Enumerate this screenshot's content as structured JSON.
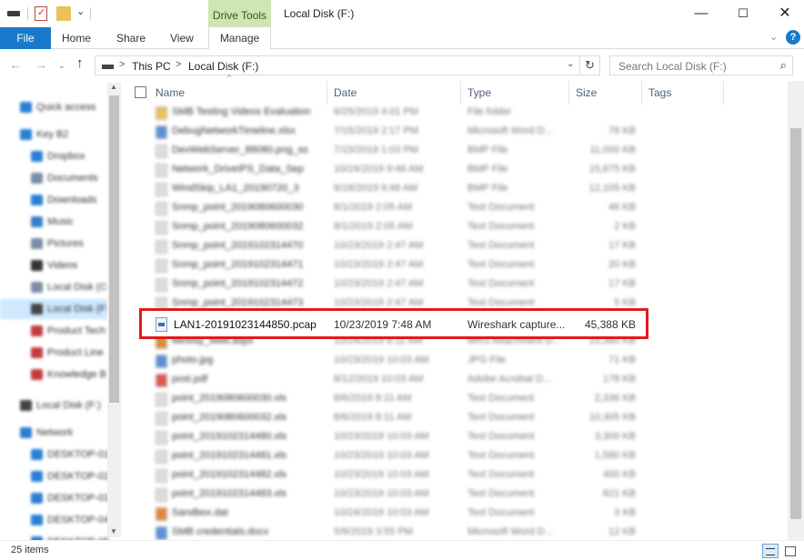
{
  "titlebar": {
    "window_title": "Local Disk (F:)",
    "context_tab": "Drive Tools",
    "minimize": "—",
    "maximize": "☐",
    "close": "✕"
  },
  "ribbon": {
    "file": "File",
    "home": "Home",
    "share": "Share",
    "view": "View",
    "manage": "Manage",
    "help": "?"
  },
  "address": {
    "back": "←",
    "forward": "→",
    "recent": "⌄",
    "up": "↑",
    "crumbs": [
      "This PC",
      "Local Disk (F:)"
    ],
    "separator": ">",
    "dropdown": "⌄",
    "refresh": "↻",
    "search_placeholder": "Search Local Disk (F:)",
    "search_icon": "⌕"
  },
  "nav_pane": {
    "items": [
      {
        "label": "Quick access",
        "color": "#2a7fd4"
      },
      {
        "label": "Key B2",
        "color": "#2a7fd4"
      },
      {
        "label": "Dropbox",
        "color": "#2a7fd4"
      },
      {
        "label": "Documents",
        "color": "#7a8ea6"
      },
      {
        "label": "Downloads",
        "color": "#2a7fd4"
      },
      {
        "label": "Music",
        "color": "#3a7ec9"
      },
      {
        "label": "Pictures",
        "color": "#7a8ea6"
      },
      {
        "label": "Videos",
        "color": "#333333"
      },
      {
        "label": "Local Disk (C:)",
        "color": "#7a8ea6"
      },
      {
        "label": "Local Disk (F:)",
        "color": "#444444",
        "selected": true
      },
      {
        "label": "Product Tech",
        "color": "#c23b3b"
      },
      {
        "label": "Product Line",
        "color": "#c23b3b"
      },
      {
        "label": "Knowledge B",
        "color": "#c23b3b"
      },
      {
        "label": "Local Disk (F:)",
        "color": "#444444"
      },
      {
        "label": "Network",
        "color": "#2a7fd4"
      },
      {
        "label": "DESKTOP-01",
        "color": "#2a7fd4"
      },
      {
        "label": "DESKTOP-02",
        "color": "#2a7fd4"
      },
      {
        "label": "DESKTOP-03",
        "color": "#2a7fd4"
      },
      {
        "label": "DESKTOP-04",
        "color": "#2a7fd4"
      },
      {
        "label": "DESKTOP-05",
        "color": "#2a7fd4"
      }
    ]
  },
  "columns": {
    "name": "Name",
    "date": "Date",
    "type": "Type",
    "size": "Size",
    "tags": "Tags",
    "sort_arrow": "^"
  },
  "files_blurred": [
    {
      "name": "SMB Testing Videos Evaluation",
      "date": "6/25/2019 4:01 PM",
      "type": "File folder",
      "size": "",
      "icon_color": "#e8c35a"
    },
    {
      "name": "DebugNetworkTimeline.xlsx",
      "date": "7/15/2019 2:17 PM",
      "type": "Microsoft Word D...",
      "size": "78 KB",
      "icon_color": "#5b8fd6"
    },
    {
      "name": "DevWebServer_88080.png_ss",
      "date": "7/15/2019 1:03 PM",
      "type": "BMP File",
      "size": "11,000 KB",
      "icon_color": "#dddddd"
    },
    {
      "name": "Network_DriveIPS_Data_Sep",
      "date": "10/24/2019 9:46 AM",
      "type": "BMP File",
      "size": "15,675 KB",
      "icon_color": "#dddddd"
    },
    {
      "name": "WindSkip_LA1_20190720_3",
      "date": "6/18/2019 9:46 AM",
      "type": "BMP File",
      "size": "12,105 KB",
      "icon_color": "#dddddd"
    },
    {
      "name": "Snmp_point_2019080600030",
      "date": "8/1/2019 2:05 AM",
      "type": "Text Document",
      "size": "46 KB",
      "icon_color": "#dddddd"
    },
    {
      "name": "Snmp_point_2019080600032",
      "date": "8/1/2019 2:05 AM",
      "type": "Text Document",
      "size": "2 KB",
      "icon_color": "#dddddd"
    },
    {
      "name": "Snmp_point_2019102314470",
      "date": "10/23/2019 2:47 AM",
      "type": "Text Document",
      "size": "17 KB",
      "icon_color": "#dddddd"
    },
    {
      "name": "Snmp_point_2019102314471",
      "date": "10/23/2019 2:47 AM",
      "type": "Text Document",
      "size": "20 KB",
      "icon_color": "#dddddd"
    },
    {
      "name": "Snmp_point_2019102314472",
      "date": "10/23/2019 2:47 AM",
      "type": "Text Document",
      "size": "17 KB",
      "icon_color": "#dddddd"
    },
    {
      "name": "Snmp_point_2019102314473",
      "date": "10/23/2019 2:47 AM",
      "type": "Text Document",
      "size": "5 KB",
      "icon_color": "#dddddd"
    }
  ],
  "selected_file": {
    "name": "LAN1-20191023144850.pcap",
    "date": "10/23/2019 7:48 AM",
    "type": "Wireshark capture...",
    "size": "45,388 KB"
  },
  "files_blurred_after": [
    {
      "name": "Minosy_Web.aspx",
      "date": "10/24/2019 8:11 AM",
      "type": "MRS Attachment D...",
      "size": "15,380 KB",
      "icon_color": "#e08a3a"
    },
    {
      "name": "photo.jpg",
      "date": "10/23/2019 10:03 AM",
      "type": "JPG File",
      "size": "71 KB",
      "icon_color": "#5b8fd6"
    },
    {
      "name": "post.pdf",
      "date": "8/12/2019 10:03 AM",
      "type": "Adobe Acrobat D...",
      "size": "178 KB",
      "icon_color": "#e05555"
    },
    {
      "name": "point_2019080600030.xls",
      "date": "8/6/2019 8:11 AM",
      "type": "Text Document",
      "size": "2,336 KB",
      "icon_color": "#dddddd"
    },
    {
      "name": "point_2019080600032.xls",
      "date": "8/6/2019 8:11 AM",
      "type": "Text Document",
      "size": "10,305 KB",
      "icon_color": "#dddddd"
    },
    {
      "name": "point_2019102314480.xls",
      "date": "10/23/2019 10:03 AM",
      "type": "Text Document",
      "size": "3,300 KB",
      "icon_color": "#dddddd"
    },
    {
      "name": "point_2019102314481.xls",
      "date": "10/23/2019 10:03 AM",
      "type": "Text Document",
      "size": "1,580 KB",
      "icon_color": "#dddddd"
    },
    {
      "name": "point_2019102314482.xls",
      "date": "10/23/2019 10:03 AM",
      "type": "Text Document",
      "size": "400 KB",
      "icon_color": "#dddddd"
    },
    {
      "name": "point_2019102314483.xls",
      "date": "10/23/2019 10:03 AM",
      "type": "Text Document",
      "size": "821 KB",
      "icon_color": "#dddddd"
    },
    {
      "name": "Sandbox.dat",
      "date": "10/24/2019 10:03 AM",
      "type": "Text Document",
      "size": "3 KB",
      "icon_color": "#e0883a"
    },
    {
      "name": "SMB credentials.docx",
      "date": "5/9/2019 3:55 PM",
      "type": "Microsoft Word D...",
      "size": "12 KB",
      "icon_color": "#5b8fd6"
    }
  ],
  "status": {
    "count": "25 items"
  }
}
